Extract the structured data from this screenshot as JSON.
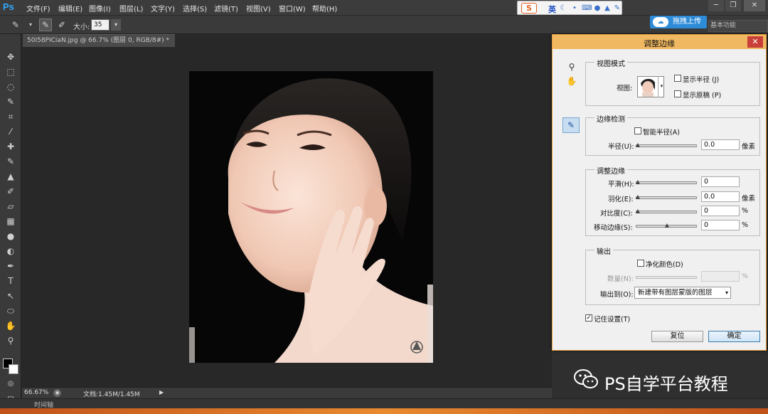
{
  "menu": {
    "logo": "Ps",
    "items": [
      "文件(F)",
      "编辑(E)",
      "图像(I)",
      "图层(L)",
      "文字(Y)",
      "选择(S)",
      "滤镜(T)",
      "视图(V)",
      "窗口(W)",
      "帮助(H)"
    ]
  },
  "ime": {
    "logo": "S",
    "lang": "英"
  },
  "options": {
    "size_label": "大小:",
    "size_value": "35"
  },
  "upload": {
    "label": "拖拽上传"
  },
  "workspace": {
    "label": "基本功能"
  },
  "document": {
    "tab": "50I58PICiaN.jpg @ 66.7% (图层 0, RGB/8#) *"
  },
  "status": {
    "zoom": "66.67%",
    "doc_info": "文档:1.45M/1.45M"
  },
  "timeline": {
    "label": "时间轴"
  },
  "watermark": {
    "text": "PS自学平台教程"
  },
  "dialog": {
    "title": "调整边缘",
    "view_mode": {
      "title": "视图模式",
      "view_label": "视图:",
      "show_radius": "显示半径 (J)",
      "show_original": "显示原稿 (P)"
    },
    "edge_detection": {
      "title": "边缘检测",
      "smart_radius": "智能半径(A)",
      "radius_label": "半径(U):",
      "radius_value": "0.0",
      "radius_unit": "像素"
    },
    "adjust_edge": {
      "title": "调整边缘",
      "smooth_label": "平滑(H):",
      "smooth_value": "0",
      "feather_label": "羽化(E):",
      "feather_value": "0.0",
      "feather_unit": "像素",
      "contrast_label": "对比度(C):",
      "contrast_value": "0",
      "contrast_unit": "%",
      "shift_label": "移动边缘(S):",
      "shift_value": "0",
      "shift_unit": "%"
    },
    "output": {
      "title": "输出",
      "decontaminate": "净化颜色(D)",
      "amount_label": "数量(N):",
      "amount_unit": "%",
      "output_to_label": "输出到(O):",
      "output_to_value": "新建带有图层蒙版的图层"
    },
    "remember": "记住设置(T)",
    "reset_label": "复位",
    "ok_label": "确定"
  }
}
